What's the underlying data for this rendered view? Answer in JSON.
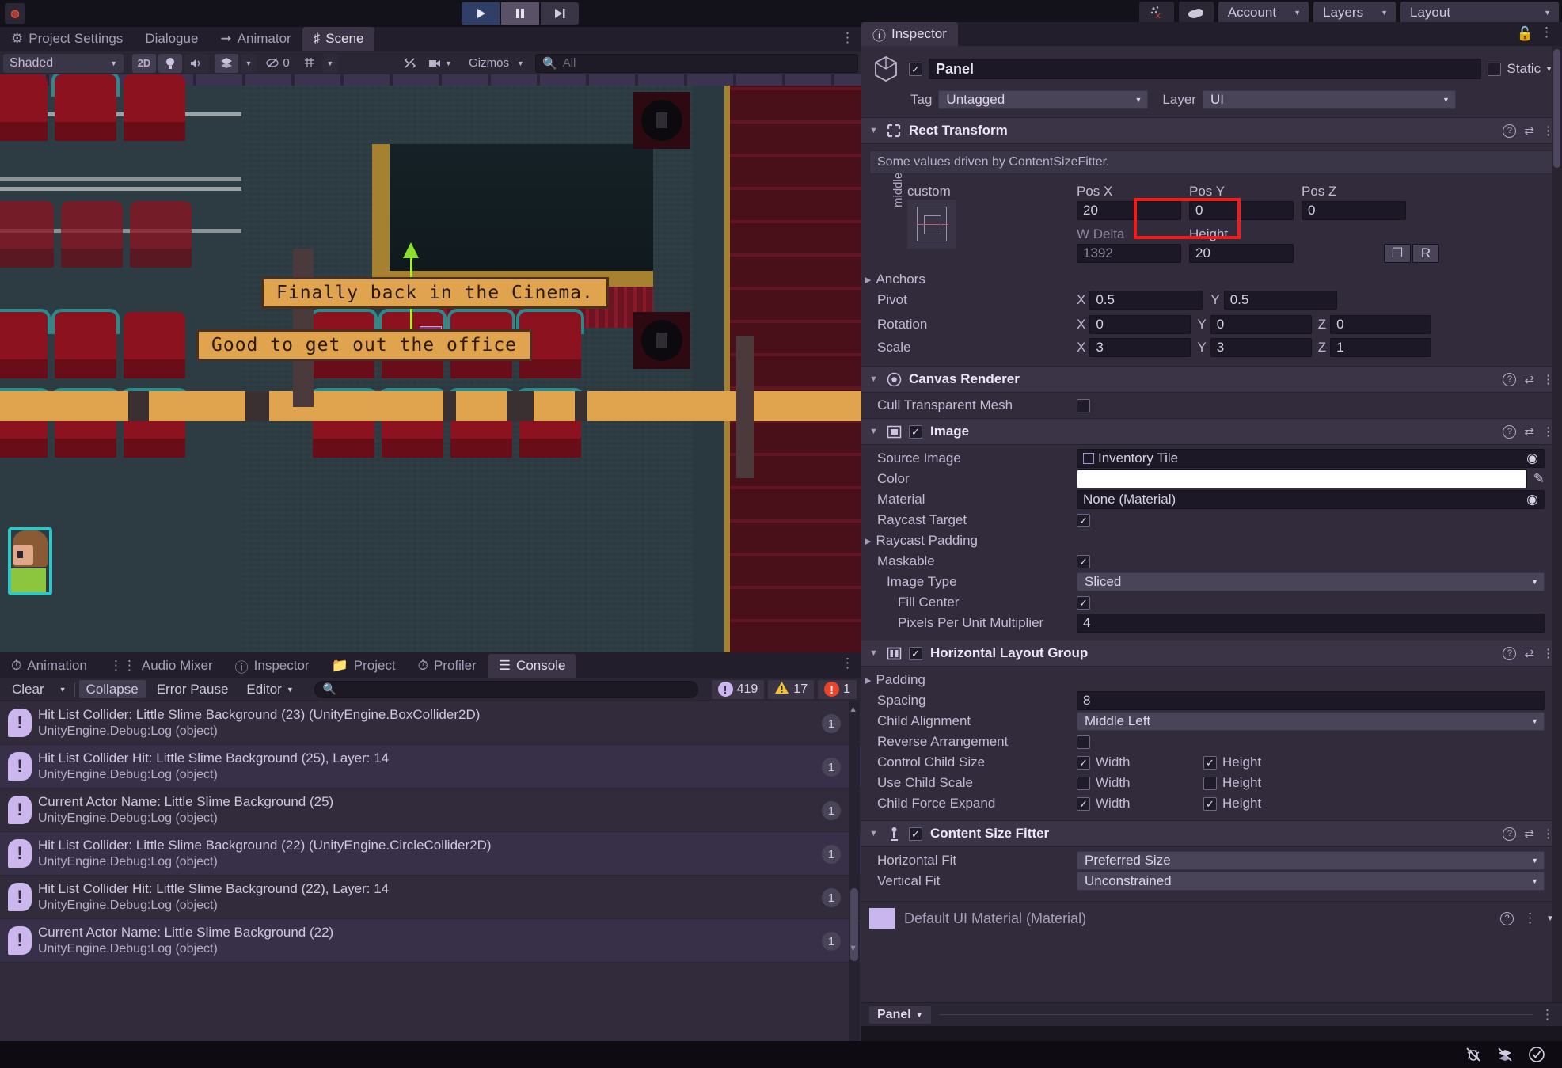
{
  "top_toolbar": {
    "logo": "unity-logo",
    "cloud_icon": "cloud-icon",
    "collab_icon": "collab-icon",
    "play_icon": "▶",
    "pause_icon": "❚❚",
    "step_icon": "▶|",
    "account_label": "Account",
    "layers_label": "Layers",
    "layout_label": "Layout"
  },
  "scene_panel": {
    "tabs": [
      {
        "label": "Project Settings",
        "icon": "gear-icon",
        "active": false
      },
      {
        "label": "Dialogue",
        "icon": "",
        "active": false
      },
      {
        "label": "Animator",
        "icon": "animator-icon",
        "active": false
      },
      {
        "label": "Scene",
        "icon": "hash-icon",
        "active": true
      }
    ],
    "toolbar": {
      "shading_mode": "Shaded",
      "mode_2d": "2D",
      "light_icon": "lightbulb-icon",
      "audio_icon": "audio-icon",
      "fx_icon": "effects-icon",
      "hidden_count": "0",
      "grid_icon": "grid-icon",
      "tools_icon": "tools-icon",
      "camera_icon": "camera-icon",
      "gizmos_label": "Gizmos",
      "search_placeholder": "All"
    },
    "dialogue_boxes": [
      {
        "text": "Finally back in the Cinema."
      },
      {
        "text": "Good to get out the office"
      }
    ]
  },
  "console_panel": {
    "tabs": [
      {
        "label": "Animation",
        "icon": "animation-icon",
        "active": false
      },
      {
        "label": "Audio Mixer",
        "icon": "mixer-icon",
        "active": false
      },
      {
        "label": "Inspector",
        "icon": "info-icon",
        "active": false
      },
      {
        "label": "Project",
        "icon": "folder-icon",
        "active": false
      },
      {
        "label": "Profiler",
        "icon": "profiler-icon",
        "active": false
      },
      {
        "label": "Console",
        "icon": "console-icon",
        "active": true
      }
    ],
    "toolbar": {
      "clear_label": "Clear",
      "collapse_label": "Collapse",
      "error_pause_label": "Error Pause",
      "editor_label": "Editor",
      "search_placeholder": "",
      "log_count": "419",
      "warning_count": "17",
      "error_count": "1"
    },
    "logs": [
      {
        "message": "Hit List Collider: Little Slime Background (23) (UnityEngine.BoxCollider2D)",
        "stack": "UnityEngine.Debug:Log (object)",
        "count": "1"
      },
      {
        "message": "Hit List Collider Hit: Little Slime Background (25), Layer: 14",
        "stack": "UnityEngine.Debug:Log (object)",
        "count": "1"
      },
      {
        "message": "Current Actor Name: Little Slime Background (25)",
        "stack": "UnityEngine.Debug:Log (object)",
        "count": "1"
      },
      {
        "message": "Hit List Collider: Little Slime Background (22) (UnityEngine.CircleCollider2D)",
        "stack": "UnityEngine.Debug:Log (object)",
        "count": "1"
      },
      {
        "message": "Hit List Collider Hit: Little Slime Background (22), Layer: 14",
        "stack": "UnityEngine.Debug:Log (object)",
        "count": "1"
      },
      {
        "message": "Current Actor Name: Little Slime Background (22)",
        "stack": "UnityEngine.Debug:Log (object)",
        "count": "1"
      }
    ]
  },
  "inspector": {
    "tab_label": "Inspector",
    "game_object": {
      "name": "Panel",
      "enabled": true,
      "static_label": "Static",
      "tag_label": "Tag",
      "tag_value": "Untagged",
      "layer_label": "Layer",
      "layer_value": "UI"
    },
    "rect_transform": {
      "title": "Rect Transform",
      "info": "Some values driven by ContentSizeFitter.",
      "anchor_preset": "custom",
      "anchor_vertical": "middle",
      "pos_x_label": "Pos X",
      "pos_y_label": "Pos Y",
      "pos_z_label": "Pos Z",
      "pos_x": "20",
      "pos_y": "0",
      "pos_z": "0",
      "width_label": "W Delta",
      "height_label": "Height",
      "width": "1392",
      "height": "20",
      "anchors_label": "Anchors",
      "pivot_label": "Pivot",
      "pivot_x": "0.5",
      "pivot_y": "0.5",
      "rotation_label": "Rotation",
      "rot_x": "0",
      "rot_y": "0",
      "rot_z": "0",
      "scale_label": "Scale",
      "scale_x": "3",
      "scale_y": "3",
      "scale_z": "1",
      "blueprint_icon": "blueprint-mode-icon",
      "raw_label": "R",
      "highlight_color": "#f21a1a"
    },
    "canvas_renderer": {
      "title": "Canvas Renderer",
      "cull_label": "Cull Transparent Mesh",
      "cull_checked": false
    },
    "image": {
      "title": "Image",
      "enabled": true,
      "source_image_label": "Source Image",
      "source_image_value": "Inventory Tile",
      "color_label": "Color",
      "color_value": "#FFFFFF",
      "material_label": "Material",
      "material_value": "None (Material)",
      "raycast_target_label": "Raycast Target",
      "raycast_target_checked": true,
      "raycast_padding_label": "Raycast Padding",
      "maskable_label": "Maskable",
      "maskable_checked": true,
      "image_type_label": "Image Type",
      "image_type_value": "Sliced",
      "fill_center_label": "Fill Center",
      "fill_center_checked": true,
      "ppu_label": "Pixels Per Unit Multiplier",
      "ppu_value": "4"
    },
    "horizontal_layout_group": {
      "title": "Horizontal Layout Group",
      "enabled": true,
      "padding_label": "Padding",
      "spacing_label": "Spacing",
      "spacing_value": "8",
      "child_alignment_label": "Child Alignment",
      "child_alignment_value": "Middle Left",
      "reverse_label": "Reverse Arrangement",
      "reverse_checked": false,
      "control_child_size_label": "Control Child Size",
      "control_width_checked": true,
      "control_height_checked": true,
      "use_child_scale_label": "Use Child Scale",
      "use_width_checked": false,
      "use_height_checked": false,
      "force_expand_label": "Child Force Expand",
      "force_width_checked": true,
      "force_height_checked": true,
      "width_label": "Width",
      "height_label": "Height"
    },
    "content_size_fitter": {
      "title": "Content Size Fitter",
      "enabled": true,
      "horizontal_fit_label": "Horizontal Fit",
      "horizontal_fit_value": "Preferred Size",
      "vertical_fit_label": "Vertical Fit",
      "vertical_fit_value": "Unconstrained"
    },
    "material_footer": {
      "name": "Default UI Material (Material)",
      "swatch_color": "#c9b6ee"
    },
    "footer": {
      "breadcrumb": "Panel"
    }
  },
  "status_bar": {
    "bug_icon": "bug-mute-icon",
    "layers_icon": "layers-mute-icon",
    "check_icon": "check-circle-icon"
  }
}
